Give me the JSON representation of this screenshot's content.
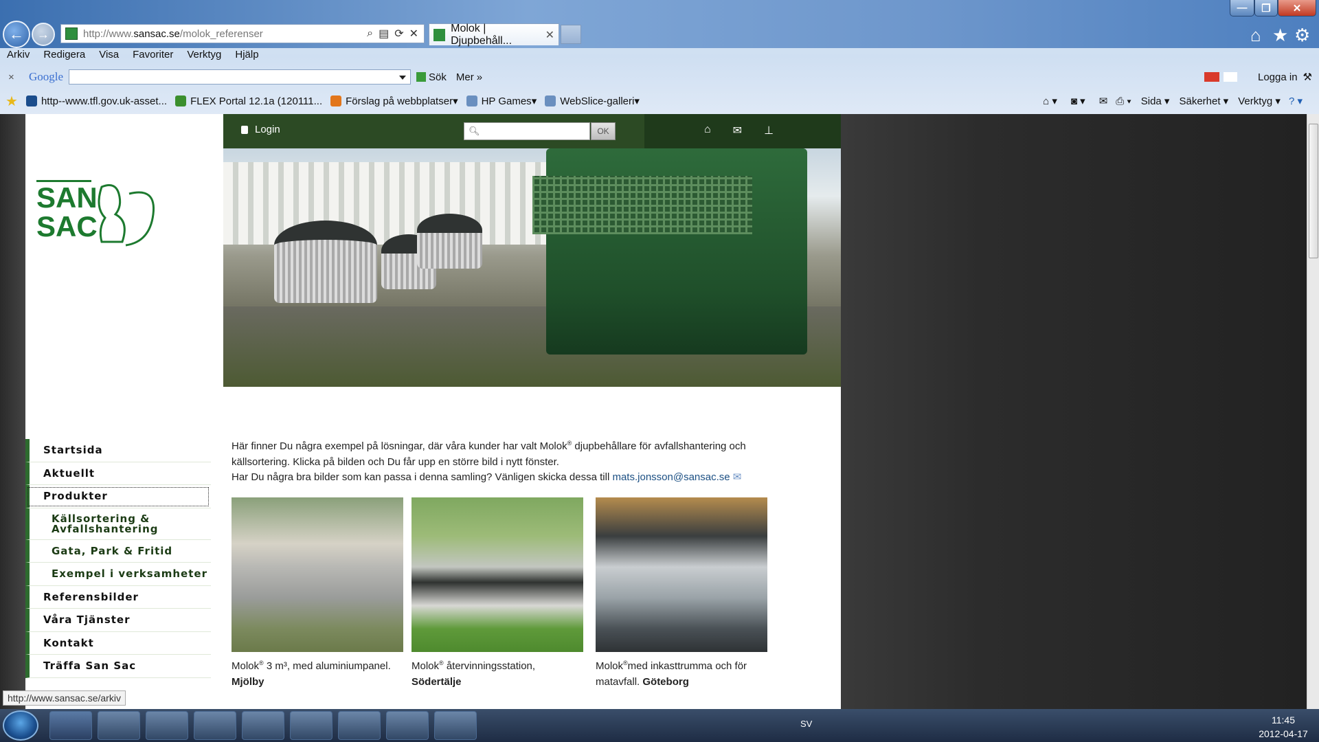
{
  "browser": {
    "window_controls": {
      "minimize": "—",
      "maximize": "❐",
      "close": "✕"
    },
    "address": {
      "prefix": "http://www.",
      "domain": "sansac.se",
      "path": "/molok_referenser"
    },
    "tab_title": "Molok | Djupbehåll...",
    "menu": [
      "Arkiv",
      "Redigera",
      "Visa",
      "Favoriter",
      "Verktyg",
      "Hjälp"
    ],
    "google": {
      "logo": "Google",
      "search_label": "Sök",
      "more_label": "Mer",
      "login_label": "Logga in"
    },
    "favorites": [
      "http--www.tfl.gov.uk-asset...",
      "FLEX Portal 12.1a (120111...",
      "Förslag på webbplatser",
      "HP Games",
      "WebSlice-galleri"
    ],
    "command_bar": [
      "Sida",
      "Säkerhet",
      "Verktyg"
    ]
  },
  "site": {
    "logo_text_top": "SAN",
    "logo_text_bottom": "SAC",
    "login_label": "Login",
    "search_ok": "OK",
    "nav": [
      {
        "label": "Startsida",
        "sub": false
      },
      {
        "label": "Aktuellt",
        "sub": false
      },
      {
        "label": "Produkter",
        "sub": false,
        "active": true
      },
      {
        "label": "Källsortering & Avfallshantering",
        "sub": true
      },
      {
        "label": "Gata, Park & Fritid",
        "sub": true
      },
      {
        "label": "Exempel i verksamheter",
        "sub": true
      },
      {
        "label": "Referensbilder",
        "sub": false
      },
      {
        "label": "Våra Tjänster",
        "sub": false
      },
      {
        "label": "Kontakt",
        "sub": false
      },
      {
        "label": "Träffa San Sac",
        "sub": false
      }
    ],
    "intro_line1_a": "Här finner Du några exempel på lösningar, där våra kunder har valt Molok",
    "intro_line1_b": " djupbehållare för avfallshantering och",
    "intro_line2": "källsortering. Klicka på bilden och Du får upp en större bild i nytt fönster.",
    "intro_line3": "Har Du några bra bilder som kan passa i denna samling? Vänligen skicka dessa till ",
    "email": "mats.jonsson@sansac.se",
    "gallery": [
      {
        "cap_a": "Molok",
        "cap_b": " 3 m³, med aluminiumpanel.",
        "place": "Mjölby"
      },
      {
        "cap_a": "Molok",
        "cap_b": " återvinningsstation,",
        "place": "Södertälje"
      },
      {
        "cap_a": "Molok",
        "cap_b": "med inkasttrumma och för matavfall. ",
        "place": "Göteborg"
      }
    ]
  },
  "status_url": "http://www.sansac.se/arkiv",
  "taskbar": {
    "lang": "SV",
    "time": "11:45",
    "date": "2012-04-17"
  },
  "colors": {
    "brand_green": "#2d6b2e",
    "topbar": "#2c4a24"
  }
}
